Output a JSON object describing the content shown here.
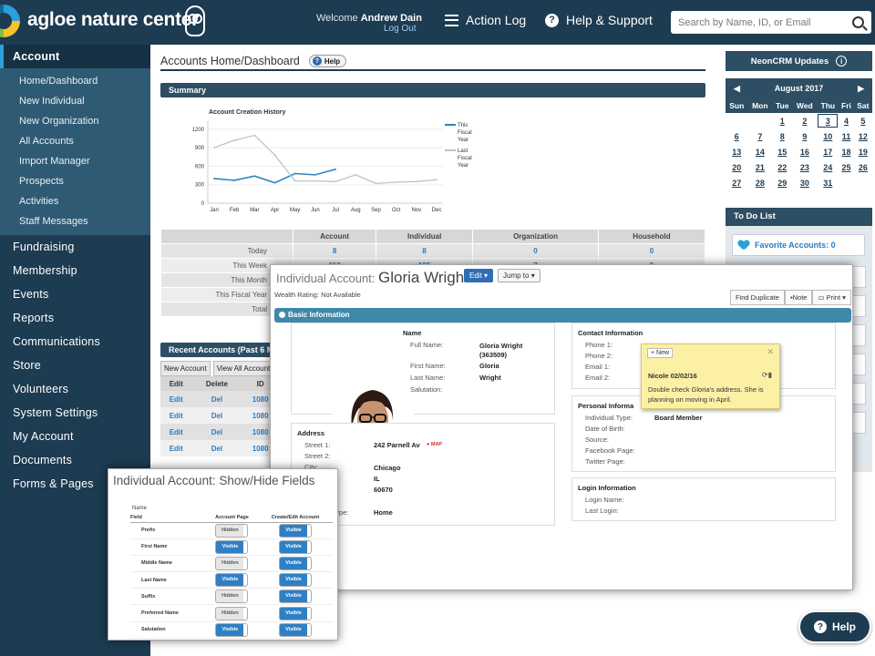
{
  "header": {
    "brand": "agloe nature center",
    "welcome_prefix": "Welcome",
    "user_name": "Andrew Dain",
    "logout": "Log Out",
    "action_log": "Action Log",
    "help_support": "Help & Support",
    "search_placeholder": "Search by Name, ID, or Email"
  },
  "sidebar": {
    "account": "Account",
    "account_items": [
      "Home/Dashboard",
      "New Individual",
      "New Organization",
      "All Accounts",
      "Import Manager",
      "Prospects",
      "Activities",
      "Staff Messages"
    ],
    "sections": [
      "Fundraising",
      "Membership",
      "Events",
      "Reports",
      "Communications",
      "Store",
      "Volunteers",
      "System Settings",
      "My Account",
      "Documents",
      "Forms & Pages"
    ]
  },
  "main": {
    "title": "Accounts Home/Dashboard",
    "help_label": "Help",
    "summary_label": "Summary",
    "recent_label": "Recent Accounts (Past 6 Mont",
    "recent_tabs": [
      "New Account",
      "View All Account"
    ],
    "recent_cols": [
      "Edit",
      "Delete",
      "ID"
    ],
    "recent_rows": [
      [
        "Edit",
        "Del",
        "1080"
      ],
      [
        "Edit",
        "Del",
        "1080"
      ],
      [
        "Edit",
        "Del",
        "1080"
      ],
      [
        "Edit",
        "Del",
        "1080"
      ]
    ]
  },
  "summary_table": {
    "cols": [
      "",
      "Account",
      "Individual",
      "Organization",
      "Household"
    ],
    "rows": [
      {
        "label": "Today",
        "values": [
          "8",
          "8",
          "0",
          "0"
        ]
      },
      {
        "label": "This Week",
        "values": [
          "112",
          "105",
          "7",
          "0"
        ]
      },
      {
        "label": "This Month",
        "values": [
          "",
          "",
          "",
          ""
        ]
      },
      {
        "label": "This Fiscal Year",
        "values": [
          "",
          "",
          "",
          ""
        ]
      },
      {
        "label": "Total",
        "values": [
          "",
          "",
          "",
          ""
        ]
      }
    ]
  },
  "chart_data": {
    "type": "line",
    "title": "Account Creation History",
    "categories": [
      "Jan",
      "Feb",
      "Mar",
      "Apr",
      "May",
      "Jun",
      "Jul",
      "Aug",
      "Sep",
      "Oct",
      "Nov",
      "Dec"
    ],
    "yticks": [
      0,
      300,
      600,
      900,
      1200
    ],
    "ylim": [
      0,
      1300
    ],
    "series": [
      {
        "name": "This Fiscal Year",
        "color": "#2a86c0",
        "values": [
          400,
          370,
          440,
          330,
          480,
          460,
          550,
          null,
          null,
          null,
          null,
          null
        ]
      },
      {
        "name": "Last Fiscal Year",
        "color": "#c2c2c2",
        "values": [
          900,
          1020,
          1100,
          780,
          360,
          360,
          350,
          460,
          320,
          340,
          350,
          380
        ]
      }
    ],
    "legend": "right"
  },
  "right": {
    "updates": "NeonCRM Updates",
    "calendar": {
      "month": "August 2017",
      "days": [
        "Sun",
        "Mon",
        "Tue",
        "Wed",
        "Thu",
        "Fri",
        "Sat"
      ],
      "weeks": [
        [
          "",
          "",
          "1",
          "2",
          "3",
          "4",
          "5"
        ],
        [
          "6",
          "7",
          "8",
          "9",
          "10",
          "11",
          "12"
        ],
        [
          "13",
          "14",
          "15",
          "16",
          "17",
          "18",
          "19"
        ],
        [
          "20",
          "21",
          "22",
          "23",
          "24",
          "25",
          "26"
        ],
        [
          "27",
          "28",
          "29",
          "30",
          "31",
          "",
          ""
        ]
      ],
      "today": "3"
    },
    "todo": "To Do List",
    "favorite": "Favorite Accounts: 0"
  },
  "help_float": "Help",
  "account": {
    "prefix": "Individual Account:",
    "name": "Gloria Wright",
    "edit": "Edit",
    "jump": "Jump to",
    "wealth": "Wealth Rating: Not Available",
    "tools": [
      "Find Duplicate",
      "Note",
      "Print"
    ],
    "basic": "Basic Information",
    "name_head": "Name",
    "name_labels": [
      "Full Name:",
      "First Name:",
      "Last Name:",
      "Salutation:"
    ],
    "full_name": "Gloria Wright",
    "full_name_id": "(363509)",
    "first_name": "Gloria",
    "last_name": "Wright",
    "address_head": "Address",
    "address_labels": [
      "Street 1:",
      "Street 2:",
      "City:",
      "",
      "",
      "",
      "Type:"
    ],
    "street1": "242 Parnell Av",
    "map": "MAP",
    "city": "Chicago",
    "state": "IL",
    "zip": "60670",
    "addr_type": "Home",
    "contact_head": "Contact Information",
    "contact_labels": [
      "Phone 1:",
      "Phone 2:",
      "Email 1:",
      "Email 2:"
    ],
    "personal_head": "Personal Informa",
    "personal_labels": [
      "Individual Type:",
      "Date of Birth:",
      "Source:",
      "Facebook Page:",
      "Twitter Page:"
    ],
    "individual_type": "Board Member",
    "login_head": "Login Information",
    "login_labels": [
      "Login Name:",
      "Last Login:"
    ],
    "note": {
      "new": "+ New",
      "author": "Nicole 02/02/16",
      "text": "Double check Gloria's address. She is planning on moving in April."
    }
  },
  "fields": {
    "title": "Individual Account: Show/Hide Fields",
    "section": "Name",
    "cols": [
      "Field",
      "Account Page",
      "Create/Edit Account"
    ],
    "rows": [
      {
        "field": "Prefix",
        "account": "Hidden",
        "create": "Visible"
      },
      {
        "field": "First Name",
        "account": "Visible",
        "create": "Visible"
      },
      {
        "field": "Middle Name",
        "account": "Hidden",
        "create": "Visible"
      },
      {
        "field": "Last Name",
        "account": "Visible",
        "create": "Visible"
      },
      {
        "field": "Suffix",
        "account": "Hidden",
        "create": "Visible"
      },
      {
        "field": "Preferred Name",
        "account": "Hidden",
        "create": "Visible"
      },
      {
        "field": "Salutation",
        "account": "Visible",
        "create": "Visible"
      }
    ]
  }
}
